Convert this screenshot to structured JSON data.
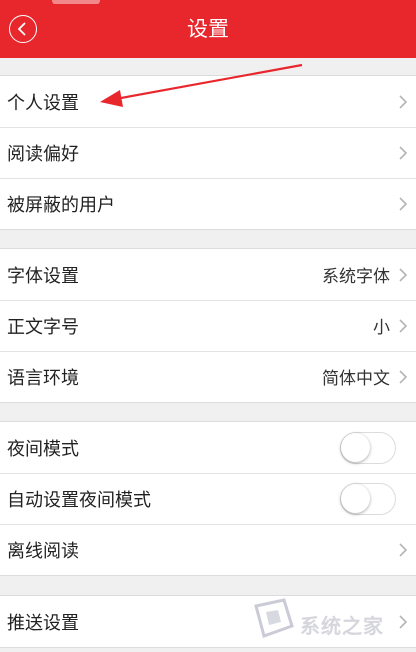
{
  "header": {
    "title": "设置",
    "background_color": "#e8272d"
  },
  "groups": [
    {
      "items": [
        {
          "label": "个人设置",
          "type": "link"
        },
        {
          "label": "阅读偏好",
          "type": "link"
        },
        {
          "label": "被屏蔽的用户",
          "type": "link"
        }
      ]
    },
    {
      "items": [
        {
          "label": "字体设置",
          "value": "系统字体",
          "type": "link"
        },
        {
          "label": "正文字号",
          "value": "小",
          "type": "link"
        },
        {
          "label": "语言环境",
          "value": "简体中文",
          "type": "link"
        }
      ]
    },
    {
      "items": [
        {
          "label": "夜间模式",
          "type": "toggle",
          "on": false
        },
        {
          "label": "自动设置夜间模式",
          "type": "toggle",
          "on": false
        },
        {
          "label": "离线阅读",
          "type": "link"
        }
      ]
    },
    {
      "items": [
        {
          "label": "推送设置",
          "type": "link"
        }
      ]
    }
  ],
  "annotation": {
    "color": "#e8272d",
    "target": "个人设置"
  },
  "watermark": {
    "text": "系统之家"
  }
}
